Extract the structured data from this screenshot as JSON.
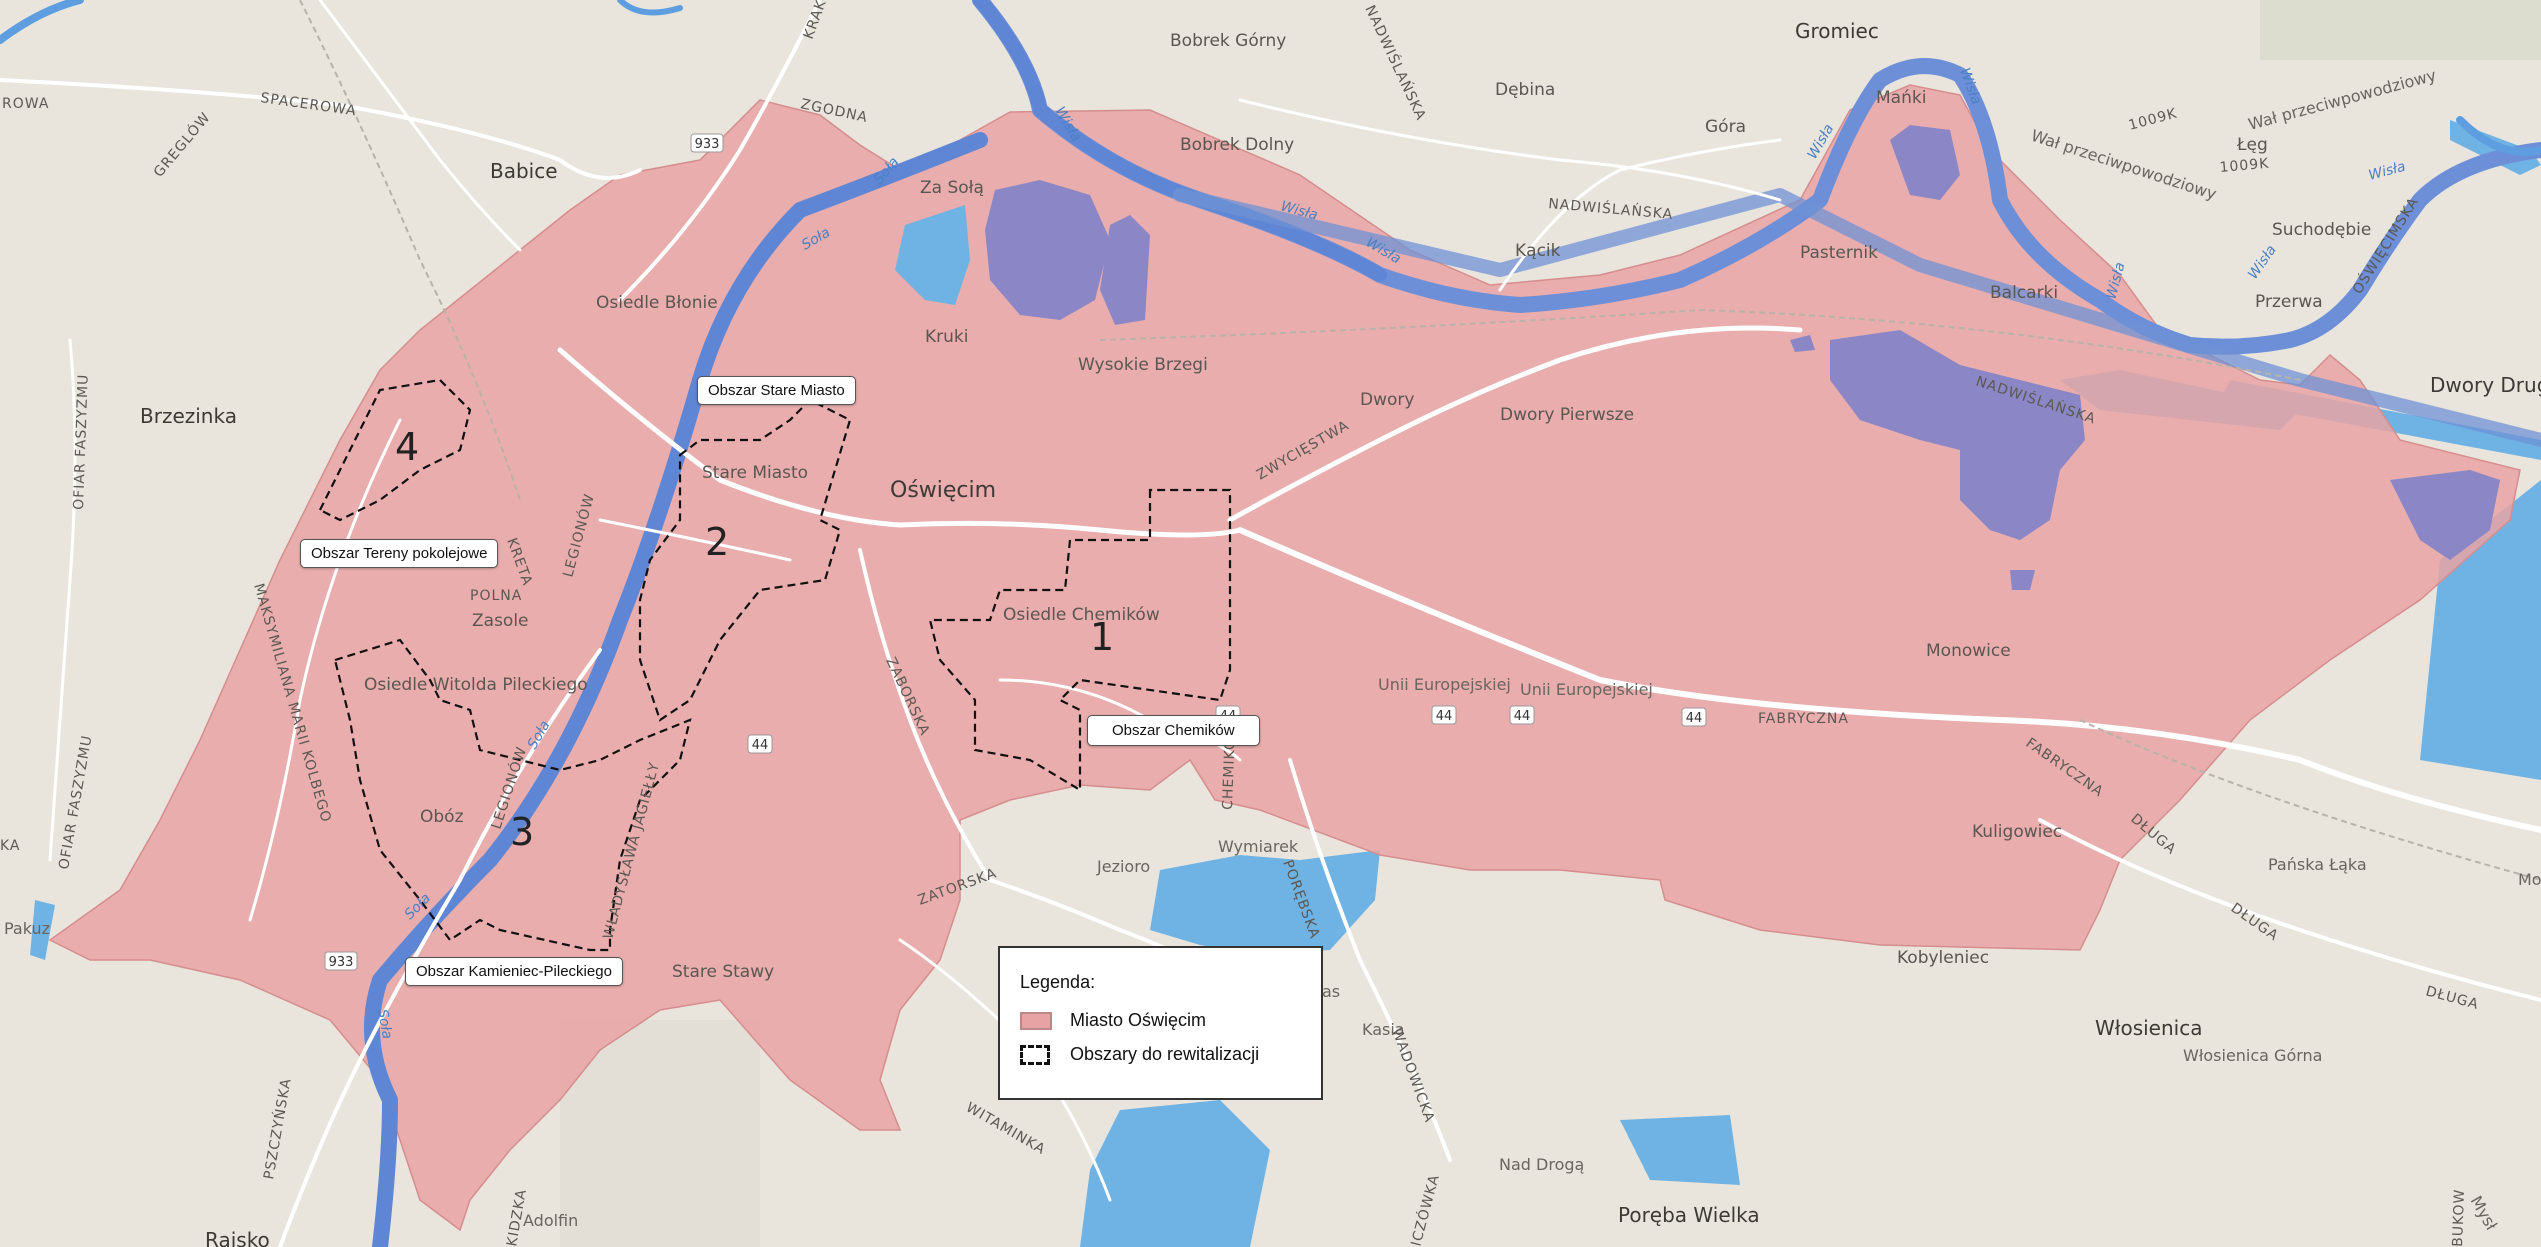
{
  "map": {
    "places": {
      "oswiecim": "Oświęcim",
      "babice": "Babice",
      "brzezinka": "Brzezinka",
      "gromiec": "Gromiec",
      "dwory_drugie": "Dwory Drug",
      "wlosienica": "Włosienica",
      "wlosienica_gorna": "Włosienica Górna",
      "poreba_wielka": "Poręba Wielka",
      "raisko": "Rajsko",
      "bobrek_gorny": "Bobrek Górny",
      "bobrek_dolny": "Bobrek Dolny",
      "debina": "Dębina",
      "gora": "Góra",
      "manki": "Mańki",
      "leg": "Łęg",
      "suchodebie": "Suchodębie",
      "przerwa": "Przerwa",
      "pasternik": "Pasternik",
      "balcarki": "Balcarki",
      "kacik": "Kącik",
      "za_sola": "Za Sołą",
      "kruki": "Kruki",
      "wysokie_brzegi": "Wysokie Brzegi",
      "dwory": "Dwory",
      "dwory_pierwsze": "Dwory Pierwsze",
      "osiedle_blonie": "Osiedle Błonie",
      "stare_miasto": "Stare Miasto",
      "osiedle_chemikow": "Osiedle Chemików",
      "zasole": "Zasole",
      "osiedle_pileckiego": "Osiedle Witolda Pileckiego",
      "oboz": "Obóz",
      "stare_stawy": "Stare Stawy",
      "monowice": "Monowice",
      "kuligowiec": "Kuligowiec",
      "kobylenec": "Kobyleniec",
      "wymiarek": "Wymiarek",
      "jezioro": "Jezioro",
      "kasia": "Kasia",
      "nad_droga": "Nad Drogą",
      "adolfin": "Adolfin",
      "pakuz": "Pakuz",
      "panska_laka": "Pańska Łąka",
      "mo": "Mo",
      "as": "as"
    },
    "roads": {
      "spacerowa": "SPACEROWA",
      "greglow": "GREGLÓW",
      "zgodna": "ZGODNA",
      "krakowska": "KRAKOWSKA",
      "nadwislanska": "NADWIŚLAŃSKA",
      "rowa": "ROWA",
      "ofiar_faszyzmu": "OFIAR FASZYZMU",
      "maksymiliana": "MAKSYMILIANA MARII KOLBEGO",
      "legionow": "LEGIONÓW",
      "kreta": "KRETA",
      "polna": "POLNA",
      "zwyciestwa": "ZWYCIĘSTWA",
      "zaborska": "ZABORSKA",
      "zatorska": "ZATORSKA",
      "chemikow": "CHEMIKÓW",
      "fabryczna": "FABRYCZNA",
      "dluga": "DŁUGA",
      "unii_europejskiej": "Unii Europejskiej",
      "wadowicka": "WADOWICKA",
      "porebska": "PORĘBSKA",
      "witaminka": "WITAMINKA",
      "pszczynska": "PSZCZYŃSKA",
      "oswiecimska": "OŚWIĘCIMSKA",
      "jagiellonska": "WŁADYSŁAWA JAGIEŁŁY",
      "kidzka": "KIDZKA",
      "ka": "KA",
      "wal": "Wał przeciwpowodziowy",
      "bukow": "BUKOW",
      "sczowka": "ICZÓWKA",
      "mysl": "Mysł",
      "shield_933": "933",
      "shield_44": "44",
      "shield_1009k": "1009K"
    },
    "rivers": {
      "wisla": "Wisła",
      "sola": "Soła"
    },
    "zones": {
      "z1": "1",
      "z2": "2",
      "z3": "3",
      "z4": "4"
    }
  },
  "callouts": {
    "stare_miasto": "Obszar Stare Miasto",
    "tereny_pokolejowe": "Obszar Tereny pokolejowe",
    "chemikow": "Obszar Chemików",
    "kamieniec": "Obszar Kamieniec-Pileckiego"
  },
  "legend": {
    "title": "Legenda:",
    "city_label": "Miasto Oświęcim",
    "areas_label": "Obszary do rewitalizacji"
  },
  "colors": {
    "background": "#e9e5dd",
    "city_fill": "#e7a3a3",
    "water": "#6fb3e4",
    "river": "#5e9ee0",
    "dashed_border": "#111111"
  }
}
